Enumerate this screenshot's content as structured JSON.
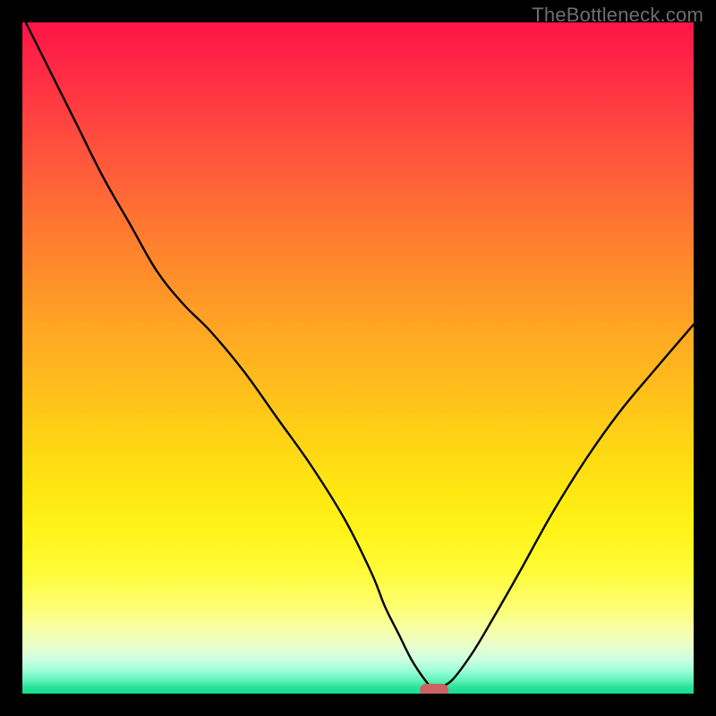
{
  "watermark": "TheBottleneck.com",
  "colors": {
    "frame": "#000000",
    "curve_stroke": "#000000",
    "marker_fill": "#cb6461"
  },
  "chart_data": {
    "type": "line",
    "title": "",
    "xlabel": "",
    "ylabel": "",
    "xlim": [
      0,
      100
    ],
    "ylim": [
      0,
      100
    ],
    "axes_visible": false,
    "grid": false,
    "gradient_stops": [
      {
        "p": 0,
        "c": "#ff1448"
      },
      {
        "p": 6,
        "c": "#ff2745"
      },
      {
        "p": 14,
        "c": "#ff4140"
      },
      {
        "p": 22,
        "c": "#ff5c3b"
      },
      {
        "p": 30,
        "c": "#ff7731"
      },
      {
        "p": 38,
        "c": "#ff8f2a"
      },
      {
        "p": 46,
        "c": "#ffa723"
      },
      {
        "p": 54,
        "c": "#ffbd1c"
      },
      {
        "p": 62,
        "c": "#ffd315"
      },
      {
        "p": 70,
        "c": "#ffe812"
      },
      {
        "p": 76,
        "c": "#fff41a"
      },
      {
        "p": 82,
        "c": "#fffb39"
      },
      {
        "p": 87,
        "c": "#fdff71"
      },
      {
        "p": 90.5,
        "c": "#f6ffa7"
      },
      {
        "p": 93,
        "c": "#e7ffcf"
      },
      {
        "p": 95,
        "c": "#caffe0"
      },
      {
        "p": 96.5,
        "c": "#9effd8"
      },
      {
        "p": 98,
        "c": "#62f2bb"
      },
      {
        "p": 99,
        "c": "#2be39a"
      },
      {
        "p": 100,
        "c": "#16dd8e"
      }
    ],
    "series": [
      {
        "name": "bottleneck-curve",
        "x": [
          0,
          4,
          8,
          12,
          16,
          20,
          24,
          28,
          33,
          38,
          43,
          48,
          52,
          54,
          56,
          58,
          60,
          61,
          62,
          64,
          67,
          70,
          74,
          79,
          84,
          89,
          94,
          100
        ],
        "y": [
          101,
          93,
          85,
          77,
          70,
          63,
          58,
          54,
          48,
          41,
          34,
          26,
          18,
          13,
          9,
          5,
          2,
          1,
          1,
          2,
          6,
          11,
          18,
          27,
          35,
          42,
          48,
          55
        ]
      }
    ],
    "marker": {
      "x": 61.3,
      "y": 0.5
    }
  }
}
